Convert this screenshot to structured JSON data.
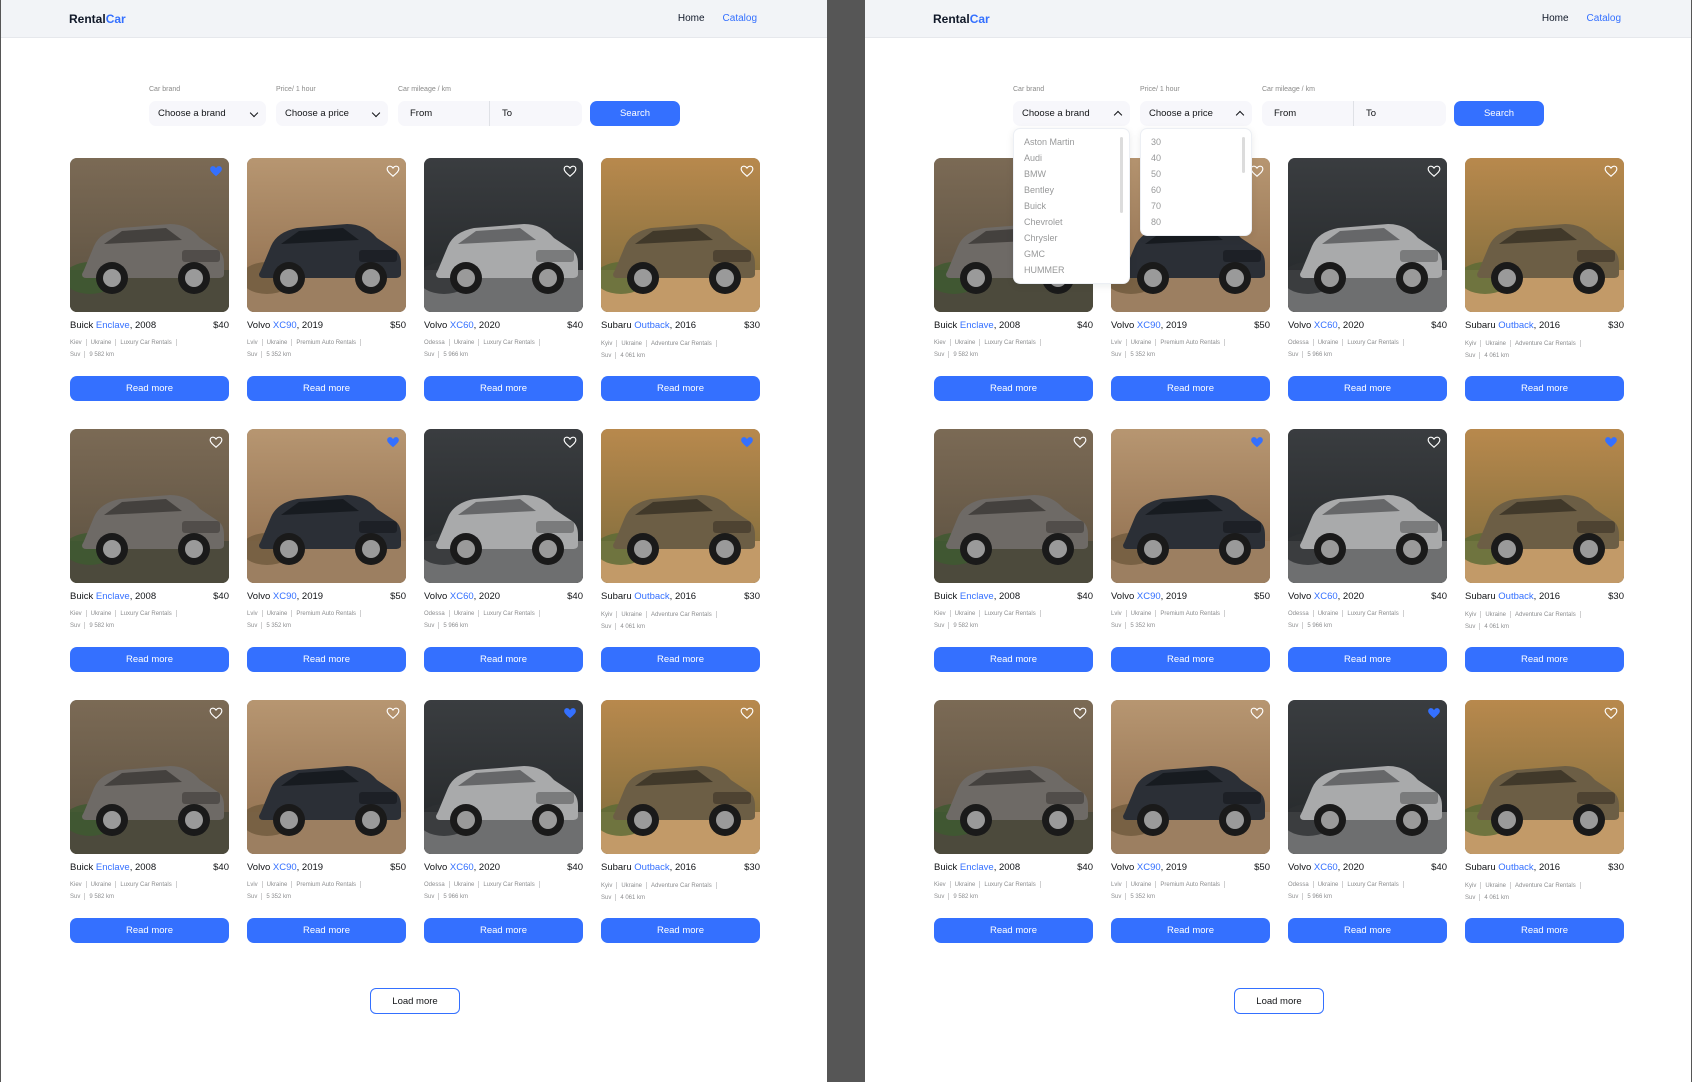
{
  "header": {
    "logo_main": "Rental",
    "logo_accent": "Car",
    "nav": [
      {
        "label": "Home",
        "active": false
      },
      {
        "label": "Catalog",
        "active": true
      }
    ]
  },
  "filters": {
    "brand_label": "Car brand",
    "brand_value": "Choose a brand",
    "price_label": "Price/ 1 hour",
    "price_value": "Choose a price",
    "mileage_label": "Car mileage / km",
    "from_placeholder": "From",
    "to_placeholder": "To",
    "search_label": "Search"
  },
  "dropdowns": {
    "brands": [
      "Aston Martin",
      "Audi",
      "BMW",
      "Bentley",
      "Buick",
      "Chevrolet",
      "Chrysler",
      "GMC",
      "HUMMER"
    ],
    "prices": [
      "30",
      "40",
      "50",
      "60",
      "70",
      "80"
    ]
  },
  "cars": [
    {
      "make": "Buick",
      "model": "Enclave",
      "year": ", 2008",
      "price": "$40",
      "city": "Kiev",
      "country": "Ukraine",
      "company": "Luxury Car Rentals",
      "type": "Suv",
      "mileage": "9 582 km",
      "variant": "buick"
    },
    {
      "make": "Volvo",
      "model": "XC90",
      "year": ", 2019",
      "price": "$50",
      "city": "Lviv",
      "country": "Ukraine",
      "company": "Premium Auto Rentals",
      "type": "Suv",
      "mileage": "5 352 km",
      "variant": "xc90"
    },
    {
      "make": "Volvo",
      "model": "XC60",
      "year": ", 2020",
      "price": "$40",
      "city": "Odessa",
      "country": "Ukraine",
      "company": "Luxury Car Rentals",
      "type": "Suv",
      "mileage": "5 966 km",
      "variant": "xc60"
    },
    {
      "make": "Subaru",
      "model": "Outback",
      "year": ", 2016",
      "price": "$30",
      "city": "Kyiv",
      "country": "Ukraine",
      "company": "Adventure Car Rentals",
      "type": "Suv",
      "mileage": "4 061 km",
      "variant": "outback"
    }
  ],
  "favorites": [
    [
      true,
      false,
      false,
      false
    ],
    [
      false,
      true,
      false,
      true
    ],
    [
      false,
      false,
      true,
      false
    ]
  ],
  "card_button_label": "Read more",
  "load_more_label": "Load more",
  "colors": {
    "accent": "#3470ff",
    "text": "#121417",
    "header_bg": "#f2f4f7",
    "backdrop": "#565656"
  }
}
